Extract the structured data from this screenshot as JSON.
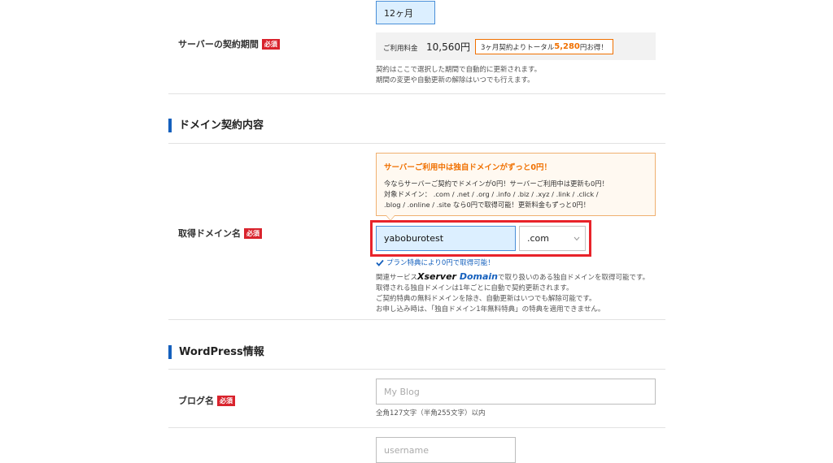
{
  "contract": {
    "label": "サーバーの契約期間",
    "required": "必須",
    "period_value": "12ヶ月",
    "fee_label": "ご利用料金",
    "fee_value": "10,560円",
    "promo_prefix": "3ヶ月契約よりトータル",
    "promo_amount": "5,280",
    "promo_suffix": "円お得！",
    "note_line1": "契約はここで選択した期間で自動的に更新されます。",
    "note_line2": "期間の変更や自動更新の解除はいつでも行えます。"
  },
  "domain_section": {
    "title": "ドメイン契約内容",
    "notice_title": "サーバーご利用中は独自ドメインがずっと0円！",
    "notice_line1": "今ならサーバーご契約でドメインが0円！サーバーご利用中は更新も0円！",
    "notice_line2": "対象ドメイン： .com / .net / .org / .info / .biz / .xyz / .link / .click /",
    "notice_line3": ".blog / .online / .site なら0円で取得可能！更新料金もずっと0円！",
    "label": "取得ドメイン名",
    "required": "必須",
    "domain_input_value": "yaboburotest",
    "tld_selected": ".com",
    "status_text": "プラン特典により0円で取得可能！",
    "info_prefix": "関連サービス",
    "info_brand_x": "Xserver",
    "info_brand_d": "Domain",
    "info_suffix": "で取り扱いのある独自ドメインを取得可能です。",
    "info_line2": "取得される独自ドメインは1年ごとに自動で契約更新されます。",
    "info_line3": "ご契約特典の無料ドメインを除き、自動更新はいつでも解除可能です。",
    "info_line4": "お申し込み時は、「独自ドメイン1年無料特典」の特典を適用できません。"
  },
  "wordpress": {
    "title": "WordPress情報",
    "blog_label": "ブログ名",
    "required": "必須",
    "blog_placeholder": "My Blog",
    "blog_note": "全角127文字（半角255文字）以内",
    "username_placeholder": "username"
  },
  "colors": {
    "accent_blue": "#1560bd",
    "required_red": "#d9232d",
    "promo_orange": "#f07000",
    "highlight_red": "#e8232a",
    "input_blue_bg": "#dcefff"
  }
}
